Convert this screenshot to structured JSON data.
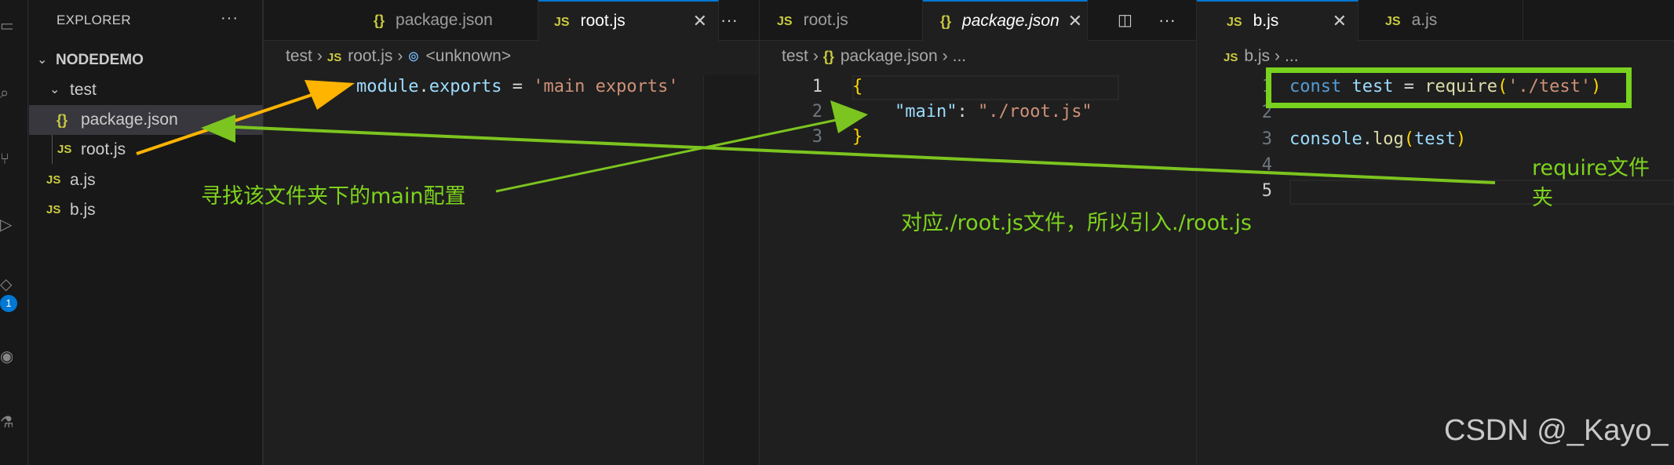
{
  "explorer": {
    "title": "EXPLORER",
    "more": "···",
    "root": "NODEDEMO",
    "items": [
      {
        "label": "test",
        "type": "folder"
      },
      {
        "label": "package.json",
        "type": "json"
      },
      {
        "label": "root.js",
        "type": "js"
      },
      {
        "label": "a.js",
        "type": "js"
      },
      {
        "label": "b.js",
        "type": "js"
      }
    ]
  },
  "activity": {
    "badge": "1"
  },
  "icons": {
    "json": "{}",
    "js": "JS",
    "chevron_down": "⌄",
    "chevron_right": "›",
    "close": "✕",
    "more": "···",
    "split": "split-editor-icon",
    "symbol": "symbol-icon"
  },
  "group1": {
    "tabs": [
      {
        "label": "package.json",
        "type": "json",
        "active": false
      },
      {
        "label": "root.js",
        "type": "js",
        "active": true
      }
    ],
    "more": "···",
    "breadcrumb": [
      "test",
      "root.js",
      "<unknown>"
    ],
    "code": {
      "line1_a": "module",
      "line1_b": ".",
      "line1_c": "exports",
      "line1_d": " = ",
      "line1_e": "'main exports'"
    }
  },
  "group2": {
    "tabs": [
      {
        "label": "root.js",
        "type": "js",
        "active": false
      },
      {
        "label": "package.json",
        "type": "json",
        "active": true
      }
    ],
    "more": "···",
    "breadcrumb": [
      "test",
      "package.json",
      "..."
    ],
    "line_numbers": [
      "1",
      "2",
      "3"
    ],
    "code": {
      "open": "{",
      "key": "\"main\"",
      "colon": ": ",
      "value": "\"./root.js\"",
      "close": "}"
    }
  },
  "group3": {
    "tabs": [
      {
        "label": "b.js",
        "type": "js",
        "active": true
      },
      {
        "label": "a.js",
        "type": "js",
        "active": false
      }
    ],
    "breadcrumb": [
      "b.js",
      "..."
    ],
    "line_numbers": [
      "1",
      "2",
      "3",
      "4",
      "5"
    ],
    "code": {
      "l1_kw": "const",
      "l1_var": "test",
      "l1_eq": " = ",
      "l1_fn": "require",
      "l1_p1": "(",
      "l1_str": "'./test'",
      "l1_p2": ")",
      "l3_obj": "console",
      "l3_dot": ".",
      "l3_fn": "log",
      "l3_p1": "(",
      "l3_arg": "test",
      "l3_p2": ")"
    }
  },
  "annotations": {
    "find_main": "寻找该文件夹下的main配置",
    "root_file": "对应./root.js文件，所以引入./root.js",
    "require_line1": "require文件",
    "require_line2": "夹"
  },
  "colors": {
    "annotation_green": "#7ed31d",
    "arrow_orange": "#ffb400",
    "arrow_green": "#7cc41f"
  },
  "watermark": "CSDN @_Kayo_"
}
